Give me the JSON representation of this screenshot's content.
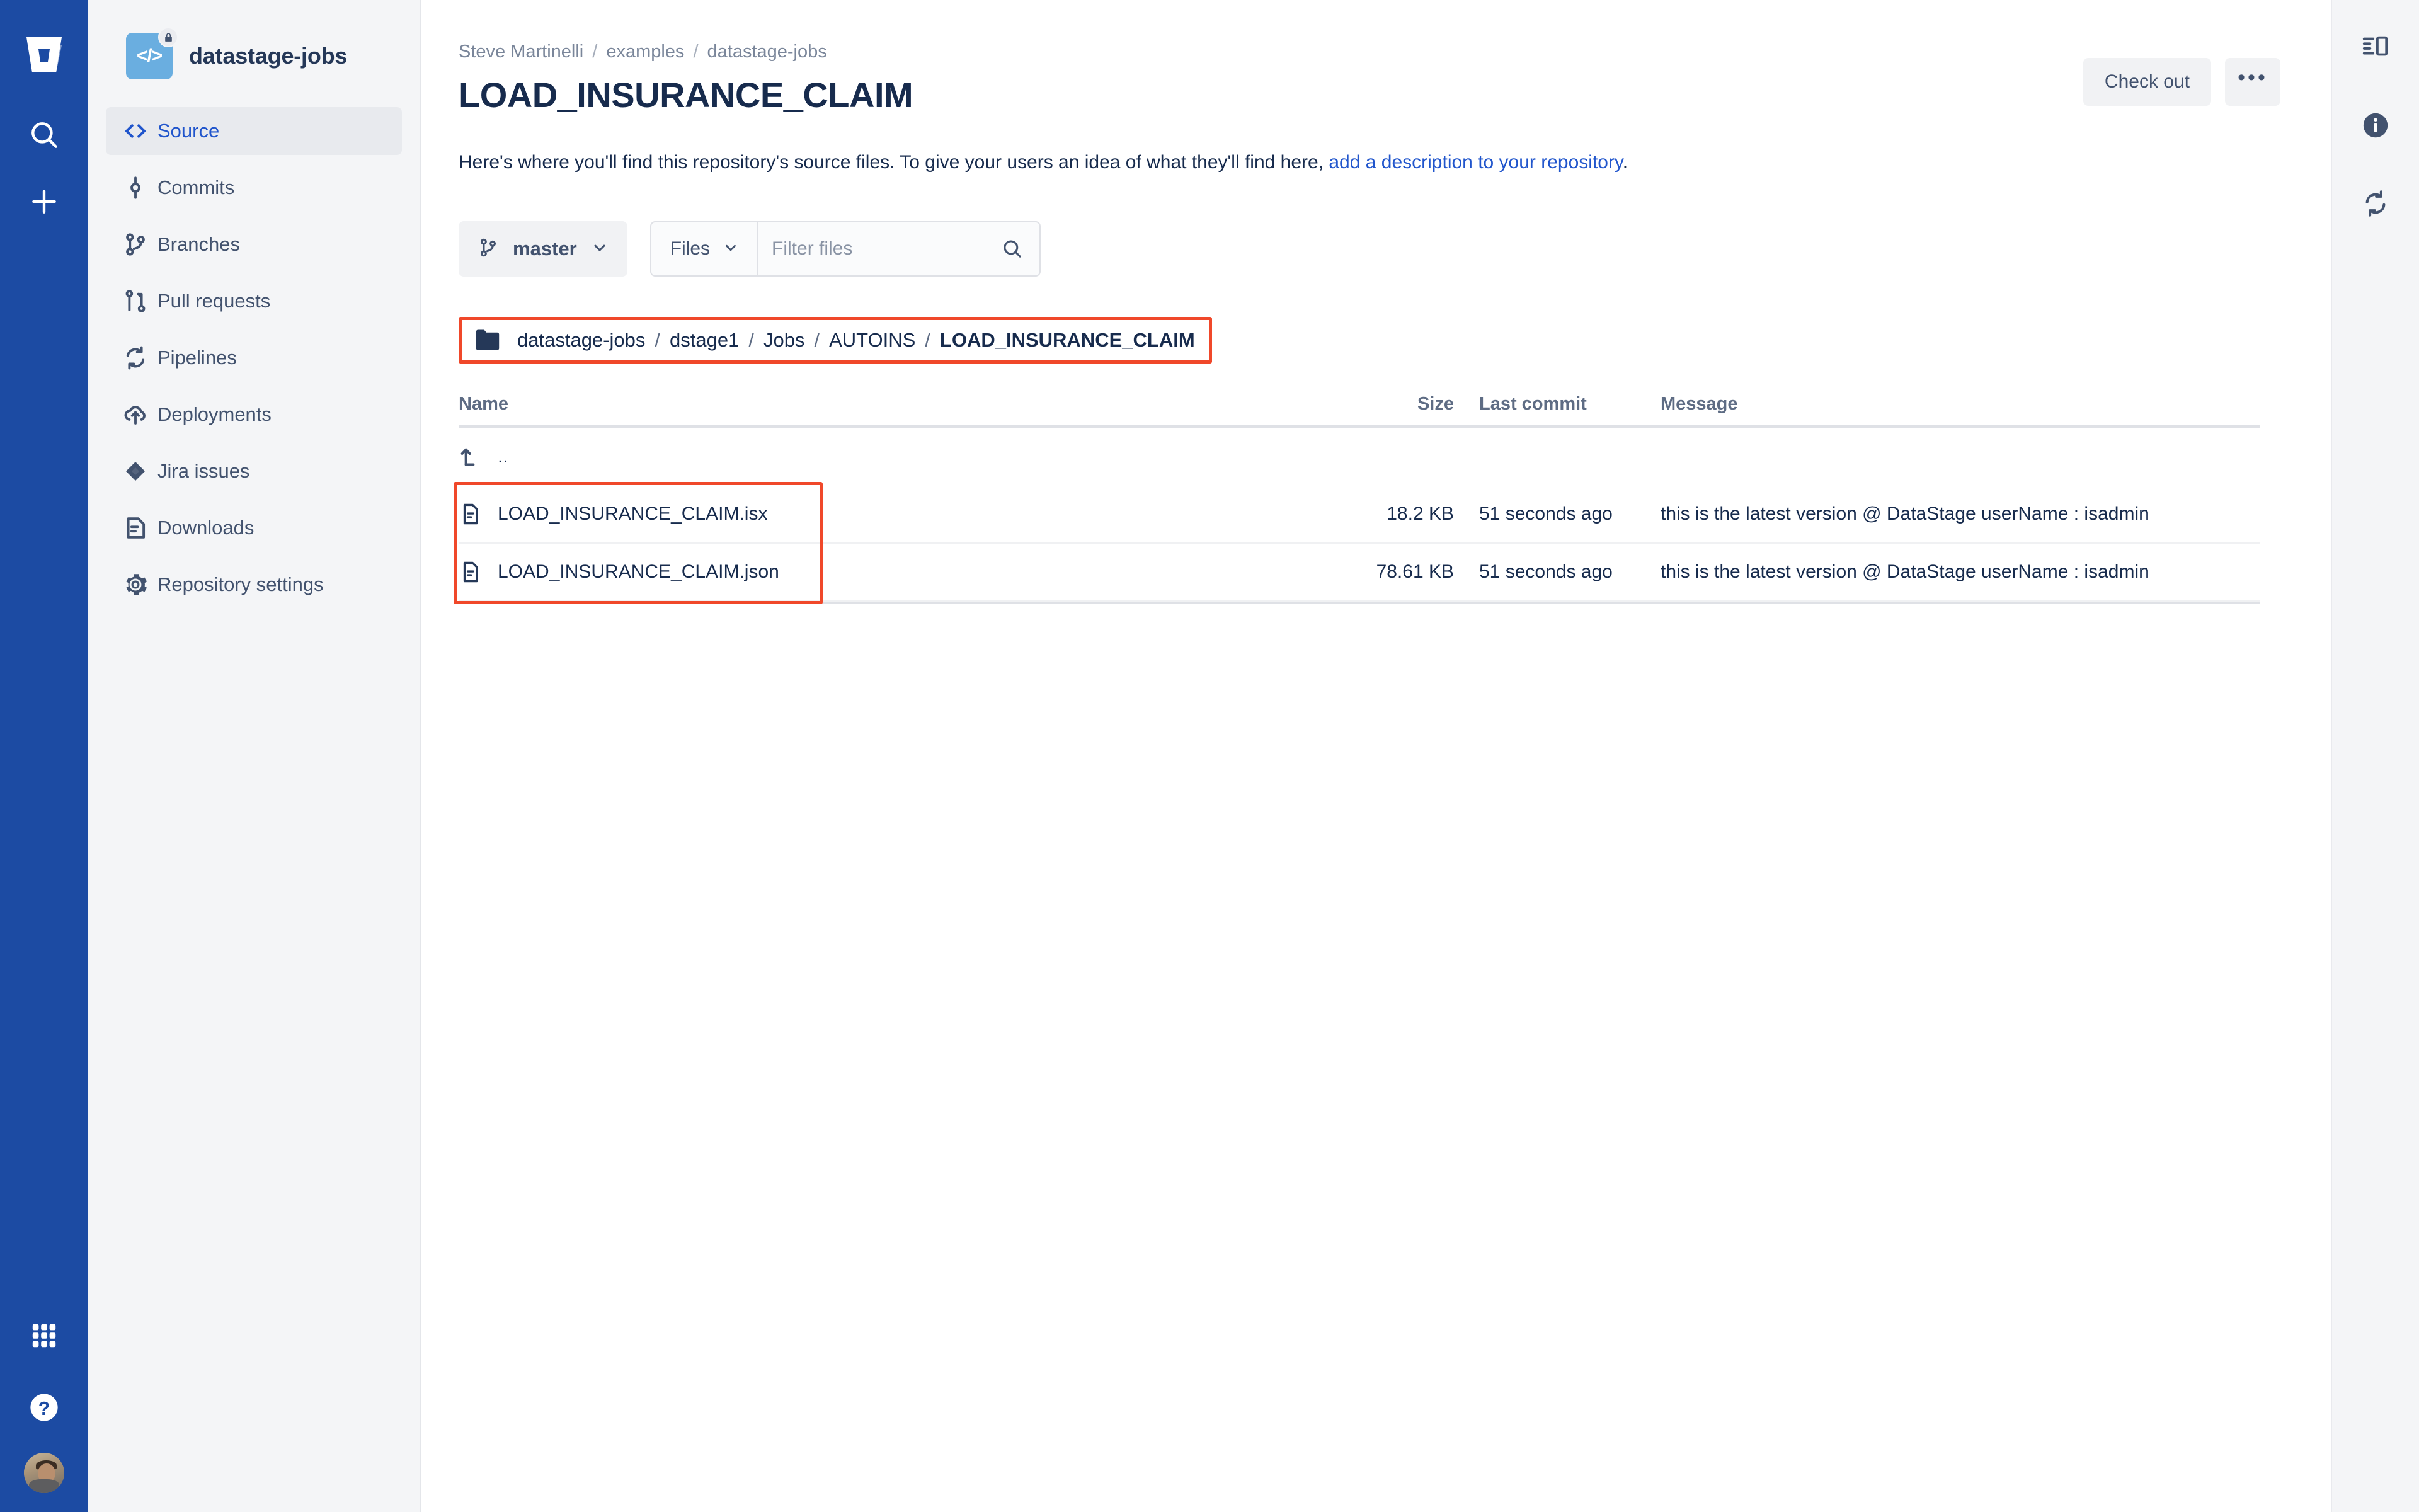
{
  "global_nav": {
    "logo_icon": "bitbucket-logo-icon",
    "items": [
      {
        "icon": "search-icon",
        "name": "search"
      },
      {
        "icon": "plus-icon",
        "name": "create"
      }
    ],
    "bottom_items": [
      {
        "icon": "app-switcher-icon",
        "name": "app-switcher"
      },
      {
        "icon": "help-icon",
        "name": "help"
      }
    ],
    "avatar_icon": "user-avatar"
  },
  "sidebar": {
    "repo_name": "datastage-jobs",
    "repo_avatar_glyph": "</>",
    "repo_private_icon": "lock-icon",
    "items": [
      {
        "label": "Source",
        "icon": "code-brackets-icon",
        "active": true
      },
      {
        "label": "Commits",
        "icon": "commit-icon",
        "active": false
      },
      {
        "label": "Branches",
        "icon": "branch-icon",
        "active": false
      },
      {
        "label": "Pull requests",
        "icon": "pull-request-icon",
        "active": false
      },
      {
        "label": "Pipelines",
        "icon": "pipelines-icon",
        "active": false
      },
      {
        "label": "Deployments",
        "icon": "deployments-cloud-icon",
        "active": false
      },
      {
        "label": "Jira issues",
        "icon": "jira-icon",
        "active": false
      },
      {
        "label": "Downloads",
        "icon": "downloads-file-icon",
        "active": false
      },
      {
        "label": "Repository settings",
        "icon": "gear-icon",
        "active": false
      }
    ]
  },
  "header": {
    "breadcrumb": [
      {
        "label": "Steve Martinelli"
      },
      {
        "label": "examples"
      },
      {
        "label": "datastage-jobs"
      }
    ],
    "breadcrumb_separator": "/",
    "title": "LOAD_INSURANCE_CLAIM",
    "intro_text": "Here's where you'll find this repository's source files. To give your users an idea of what they'll find here, ",
    "intro_link": "add a description to your repository",
    "intro_suffix": ".",
    "checkout_label": "Check out",
    "more_label": "•••"
  },
  "toolbar": {
    "branch_icon": "branch-icon",
    "branch_label": "master",
    "branch_chevron": "chevron-down-icon",
    "filter_kind_label": "Files",
    "filter_kind_chevron": "chevron-down-icon",
    "filter_placeholder": "Filter files",
    "filter_value": "",
    "search_icon": "search-icon"
  },
  "path_bar": {
    "folder_icon": "folder-icon",
    "separator": "/",
    "segments": [
      {
        "label": "datastage-jobs",
        "current": false
      },
      {
        "label": "dstage1",
        "current": false
      },
      {
        "label": "Jobs",
        "current": false
      },
      {
        "label": "AUTOINS",
        "current": false
      },
      {
        "label": "LOAD_INSURANCE_CLAIM",
        "current": true
      }
    ],
    "highlight_color": "#f0482a"
  },
  "file_table": {
    "columns": {
      "name": "Name",
      "size": "Size",
      "last_commit": "Last commit",
      "message": "Message"
    },
    "parent_row": {
      "icon": "arrow-up-left-icon",
      "label": ".."
    },
    "rows": [
      {
        "icon": "file-icon",
        "name": "LOAD_INSURANCE_CLAIM.isx",
        "size": "18.2 KB",
        "last_commit": "51 seconds ago",
        "message": "this is the latest version @ DataStage userName : isadmin"
      },
      {
        "icon": "file-icon",
        "name": "LOAD_INSURANCE_CLAIM.json",
        "size": "78.61 KB",
        "last_commit": "51 seconds ago",
        "message": "this is the latest version @ DataStage userName : isadmin"
      }
    ]
  },
  "right_rail": {
    "items": [
      {
        "icon": "sidebar-toggle-icon",
        "name": "toggle-sidebar"
      },
      {
        "icon": "info-icon",
        "name": "info"
      },
      {
        "icon": "sync-icon",
        "name": "sync"
      }
    ]
  },
  "colors": {
    "brand_blue": "#1c4ba3",
    "link_blue": "#2055cc",
    "text_dark": "#172b4d",
    "text_muted": "#5e6c84",
    "sidebar_bg": "#f4f5f7",
    "highlight_red": "#f0482a"
  }
}
